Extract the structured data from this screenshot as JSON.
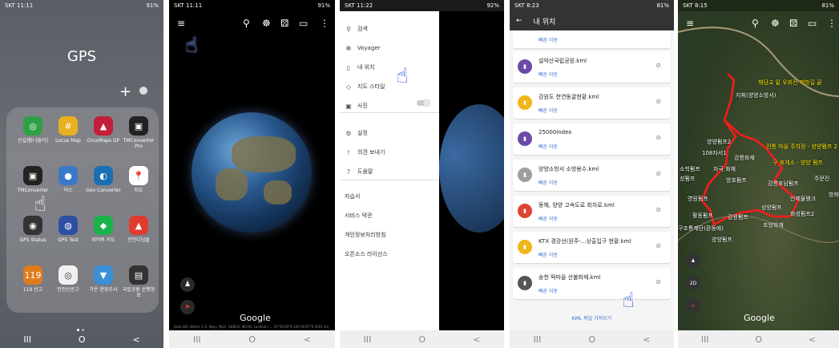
{
  "panel1": {
    "status": {
      "time": "SKT 11:11",
      "right": "91%"
    },
    "folder_title": "GPS",
    "add_glyph": "+",
    "apps": [
      {
        "label": "산길샘[나들이]",
        "color": "#2ea043",
        "icon": "◎"
      },
      {
        "label": "Locus Map",
        "color": "#e8b020",
        "icon": "#"
      },
      {
        "label": "OruxMaps GP",
        "color": "#c41e3a",
        "icon": "▲"
      },
      {
        "label": "TMConverter Pro",
        "color": "#222222",
        "icon": "▣"
      },
      {
        "label": "TMConverter",
        "color": "#222222",
        "icon": "▣"
      },
      {
        "label": "어스",
        "color": "#3a78c9",
        "icon": "●"
      },
      {
        "label": "Geo Converter",
        "color": "#1a6fb3",
        "icon": "◐"
      },
      {
        "label": "지도",
        "color": "#ffffff",
        "icon": "📍"
      },
      {
        "label": "GPS Status",
        "color": "#333333",
        "icon": "◉"
      },
      {
        "label": "GPS Test",
        "color": "#2d4fa3",
        "icon": "◍"
      },
      {
        "label": "네이버 지도",
        "color": "#19b34a",
        "icon": "◆"
      },
      {
        "label": "안전디딤돌",
        "color": "#e03b2f",
        "icon": "▲"
      },
      {
        "label": "119 신고",
        "color": "#e07b1a",
        "icon": "119"
      },
      {
        "label": "안전신문고",
        "color": "#f0f0f0",
        "icon": "◎"
      },
      {
        "label": "가온 현장조사",
        "color": "#3a8fd6",
        "icon": "▼"
      },
      {
        "label": "국립공원 산행정보",
        "color": "#333333",
        "icon": "▤"
      }
    ],
    "nav": [
      "III",
      "O",
      "<"
    ]
  },
  "panel2": {
    "status": {
      "time": "SKT 11:11",
      "right": "91%"
    },
    "toolbar": {
      "menu": "≡",
      "search": "⚲",
      "voyager": "☸",
      "dice": "⚄",
      "ruler": "▭",
      "more": "⋮"
    },
    "fab_person": "♟",
    "fab_compass": "➤",
    "logo": "Google",
    "attribution": "Data SIO, NOAA, U.S. Navy, NGA, GEBCO, IBCAO; Landsat / ... 52°56'49\"N 100°56'07\"E 6591 km",
    "nav": [
      "III",
      "O",
      "<"
    ]
  },
  "panel3": {
    "status": {
      "time": "SKT 11:22",
      "right": "92%"
    },
    "menu": [
      {
        "icon": "⚲",
        "label": "검색"
      },
      {
        "icon": "☸",
        "label": "Voyager"
      },
      {
        "icon": "▯",
        "label": "내 위치"
      },
      {
        "icon": "◇",
        "label": "지도 스타일"
      },
      {
        "icon": "▣",
        "label": "사진"
      },
      {
        "icon": "⚙",
        "label": "설정"
      },
      {
        "icon": "!",
        "label": "의견 보내기"
      },
      {
        "icon": "?",
        "label": "도움말"
      }
    ],
    "links": [
      "자습서",
      "서비스 약관",
      "개인정보처리방침",
      "오픈소스 라이선스"
    ],
    "nav": [
      "III",
      "O",
      "<"
    ]
  },
  "panel4": {
    "status": {
      "time": "SKT 8:23",
      "right": "81%"
    },
    "back": "←",
    "title": "내 위치",
    "fly_label": "빠른 이동",
    "items": [
      {
        "name": "설악산국립공원.kml",
        "color": "#6b4aa8"
      },
      {
        "name": "강원도 천연동굴현황.kml",
        "color": "#f2b51a"
      },
      {
        "name": "25000index",
        "color": "#6b4aa8"
      },
      {
        "name": "양양소방서 소방용수.kml",
        "color": "#9e9e9e"
      },
      {
        "name": "동해, 양양 고속도로 회차로.kml",
        "color": "#e0432f"
      },
      {
        "name": "KTX 경강선(원주-...상출입구 현황.kml",
        "color": "#f2b51a"
      },
      {
        "name": "송천 떡마을 산불화재.kml",
        "color": "#555555"
      }
    ],
    "import_label": "KML 파일 가져오기",
    "nav": [
      "III",
      "O",
      "<"
    ]
  },
  "panel5": {
    "status": {
      "time": "SKT 8:15",
      "right": "81%"
    },
    "labels_yellow": [
      "해담교 밑 우회전 제방길 끝",
      "전통 마을 주차장 - 양양펌프 2",
      "구 휴게소 - 양양 펌프"
    ],
    "labels_white": [
      "지휘(양양소방서)",
      "양양펌프2",
      "108자서1",
      "강릉화재",
      "소학펌프",
      "자극 화재",
      "성펌프",
      "방호펌프",
      "강릉포남펌프",
      "주문진",
      "인제물탱크",
      "영원펌프",
      "화성펌프2",
      "활동펌프",
      "강원펌프",
      "호양화재",
      "구조통제단(환동애)",
      "양양펌프",
      "상양펌프",
      "방화"
    ],
    "fab_person": "♟",
    "fab_2d": "2D",
    "logo": "Google",
    "nav": [
      "III",
      "O",
      "<"
    ]
  }
}
